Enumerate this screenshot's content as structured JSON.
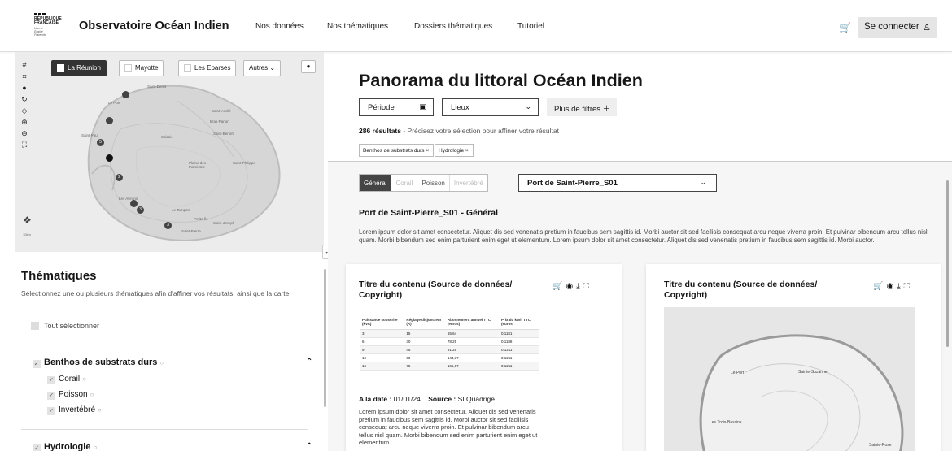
{
  "header": {
    "logo_lines": [
      "RÉPUBLIQUE",
      "FRANÇAISE"
    ],
    "motto": [
      "Liberté",
      "Égalité",
      "Fraternité"
    ],
    "brand": "Observatoire Océan Indien",
    "nav": [
      "Nos données",
      "Nos thématiques",
      "Dossiers thématiques",
      "Tutoriel"
    ],
    "cart_icon": "cart-icon",
    "login_label": "Se connecter",
    "user_icon": "user-icon"
  },
  "map": {
    "tools": [
      "#",
      "⌗",
      "●",
      "↻",
      "◇",
      "⊕",
      "⊖",
      "⛶"
    ],
    "tabs": [
      "La Réunion",
      "Mayotte",
      "Les Eparses",
      "Autres"
    ],
    "active_tab": "La Réunion",
    "places": [
      "Saint-Denis",
      "Le Port",
      "Saint-André",
      "Bras-Panon",
      "Saint-Benoît",
      "Saint-Paul",
      "Salazie",
      "Saint-Philippe",
      "Saint-Pierre",
      "Les Avirons",
      "Le Tampon",
      "Petite-Île",
      "Saint-Joseph",
      "Plaine des Palmistes"
    ],
    "markers": [
      "5",
      "2",
      "3",
      "3",
      "3"
    ],
    "scale": "10km"
  },
  "thematiques": {
    "title": "Thématiques",
    "subtitle": "Sélectionnez une ou plusieurs thématiques afin d'affiner vos résultats, ainsi que la carte",
    "select_all": "Tout sélectionner",
    "categories": [
      {
        "label": "Benthos de substrats durs",
        "subs": [
          "Corail",
          "Poisson",
          "Invertébré"
        ]
      },
      {
        "label": "Hydrologie",
        "subs": []
      }
    ]
  },
  "main": {
    "title": "Panorama du littoral Océan Indien",
    "filters": {
      "period": "Période",
      "places": "Lieux",
      "more": "Plus de filtres"
    },
    "results_count": "286 résultats",
    "results_hint": " - Précisez votre sélection pour affiner votre résultat",
    "chips": [
      "Benthos de substrats durs ×",
      "Hydrologie ×"
    ],
    "seg_tabs": [
      "Général",
      "Corail",
      "Poisson",
      "Invertébré"
    ],
    "active_seg": "Général",
    "station": "Port de Saint-Pierre_S01",
    "section_title": "Port de Saint-Pierre_S01 - Général",
    "lorem": "Lorem ipsum dolor sit amet consectetur. Aliquet dis sed venenatis pretium in faucibus sem sagittis id. Morbi auctor sit sed facilisis consequat arcu neque viverra proin. Et pulvinar bibendum arcu tellus nisl quam. Morbi bibendum sed enim parturient enim eget ut elementum. Lorem ipsum dolor sit amet consectetur. Aliquet dis sed venenatis pretium in faucibus sem sagittis id. Morbi auctor.",
    "card1": {
      "title": "Titre du contenu (Source de données/ Copyright)",
      "icons": [
        "cart-icon",
        "layers-icon",
        "download-icon",
        "expand-icon"
      ],
      "table": {
        "headers": [
          "Puissance souscrite (kVA)",
          "Réglage disjoncteur (A)",
          "Abonnement annuel TTC (euros)",
          "Prix du kWh TTC (euros)"
        ],
        "rows": [
          [
            "3",
            "15",
            "65,64",
            "0,1181"
          ],
          [
            "6",
            "30",
            "78,25",
            "0,1188"
          ],
          [
            "9",
            "45",
            "91,25",
            "0,1211"
          ],
          [
            "12",
            "60",
            "144,37",
            "0,1211"
          ],
          [
            "15",
            "75",
            "166,67",
            "0,1211"
          ]
        ]
      },
      "date_label": "A la date :",
      "date": "01/01/24",
      "source_label": "Source :",
      "source": "SI Quadrige",
      "lorem": "Lorem ipsum dolor sit amet consectetur. Aliquet dis sed venenatis pretium in faucibus sem sagittis id. Morbi auctor sit sed facilisis consequat arcu neque viverra proin. Et pulvinar bibendum arcu tellus nisl quam. Morbi bibendum sed enim parturient enim eget ut elementum."
    },
    "card2": {
      "title": "Titre du contenu (Source de données/ Copyright)",
      "icons": [
        "cart-icon",
        "layers-icon",
        "download-icon",
        "expand-icon"
      ],
      "places": [
        "Le Port",
        "Sainte-Suzanne",
        "Les Trois-Bassins",
        "Sainte-Rose"
      ]
    }
  }
}
